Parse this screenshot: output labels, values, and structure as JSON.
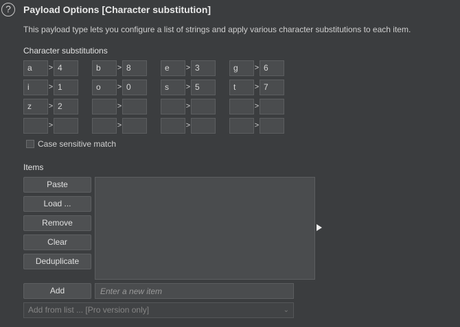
{
  "header": {
    "title": "Payload Options [Character substitution]",
    "description": "This payload type lets you configure a list of strings and apply various character substitutions to each item."
  },
  "substitutions": {
    "label": "Character substitutions",
    "separator": ">",
    "rows": [
      [
        {
          "from": "a",
          "to": "4"
        },
        {
          "from": "b",
          "to": "8"
        },
        {
          "from": "e",
          "to": "3"
        },
        {
          "from": "g",
          "to": "6"
        }
      ],
      [
        {
          "from": "i",
          "to": "1"
        },
        {
          "from": "o",
          "to": "0"
        },
        {
          "from": "s",
          "to": "5"
        },
        {
          "from": "t",
          "to": "7"
        }
      ],
      [
        {
          "from": "z",
          "to": "2"
        },
        {
          "from": "",
          "to": ""
        },
        {
          "from": "",
          "to": ""
        },
        {
          "from": "",
          "to": ""
        }
      ],
      [
        {
          "from": "",
          "to": ""
        },
        {
          "from": "",
          "to": ""
        },
        {
          "from": "",
          "to": ""
        },
        {
          "from": "",
          "to": ""
        }
      ]
    ],
    "case_sensitive_label": "Case sensitive match",
    "case_sensitive_checked": false
  },
  "items": {
    "label": "Items",
    "buttons": [
      "Paste",
      "Load ...",
      "Remove",
      "Clear",
      "Deduplicate"
    ],
    "list_values": [],
    "add_button": "Add",
    "new_item_placeholder": "Enter a new item",
    "add_from_list": "Add from list ... [Pro version only]"
  },
  "icons": {
    "help": "help-icon",
    "separator": "chevron-right-icon",
    "expand": "triangle-right-icon",
    "dropdown": "chevron-down-icon"
  },
  "colors": {
    "background": "#3b3d3f",
    "field": "#4a4c4e",
    "button": "#4e5052",
    "text": "#d4d4d4"
  }
}
